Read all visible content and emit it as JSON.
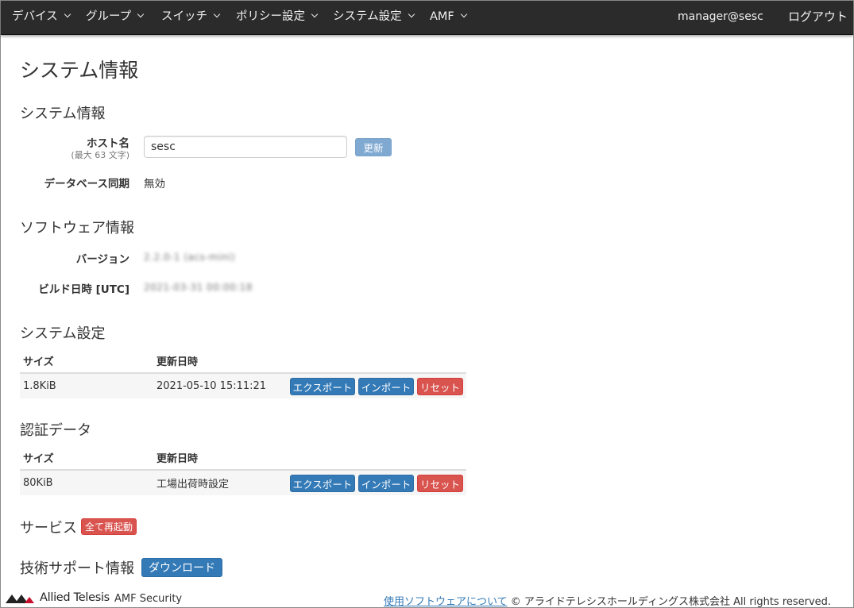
{
  "nav": {
    "items": [
      {
        "label": "デバイス"
      },
      {
        "label": "グループ"
      },
      {
        "label": "スイッチ"
      },
      {
        "label": "ポリシー設定"
      },
      {
        "label": "システム設定"
      },
      {
        "label": "AMF"
      }
    ],
    "user": "manager@sesc",
    "logout": "ログアウト"
  },
  "page_title": "システム情報",
  "system_info": {
    "heading": "システム情報",
    "hostname_label": "ホスト名",
    "hostname_hint": "(最大 63 文字)",
    "hostname_value": "sesc",
    "update_button": "更新",
    "dbsync_label": "データベース同期",
    "dbsync_value": "無効"
  },
  "software_info": {
    "heading": "ソフトウェア情報",
    "version_label": "バージョン",
    "version_value": "2.2.0-1 (acs-mini)",
    "build_label": "ビルド日時 [UTC]",
    "build_value": "2021-03-31 00:00:18"
  },
  "system_settings": {
    "heading": "システム設定",
    "col_size": "サイズ",
    "col_updated": "更新日時",
    "size": "1.8KiB",
    "updated": "2021-05-10 15:11:21",
    "export": "エクスポート",
    "import": "インポート",
    "reset": "リセット"
  },
  "auth_data": {
    "heading": "認証データ",
    "col_size": "サイズ",
    "col_updated": "更新日時",
    "size": "80KiB",
    "updated": "工場出荷時設定",
    "export": "エクスポート",
    "import": "インポート",
    "reset": "リセット"
  },
  "services": {
    "heading": "サービス",
    "restart_all": "全て再起動"
  },
  "tech_support": {
    "heading": "技術サポート情報",
    "download": "ダウンロード"
  },
  "footer": {
    "brand": "Allied Telesis",
    "product": "AMF Security",
    "software_link": "使用ソフトウェアについて",
    "copyright": "© アライドテレシスホールディングス株式会社 All rights reserved."
  },
  "colors": {
    "navbar": "#2b2b2b",
    "primary": "#337ab7",
    "danger": "#d9534f"
  }
}
